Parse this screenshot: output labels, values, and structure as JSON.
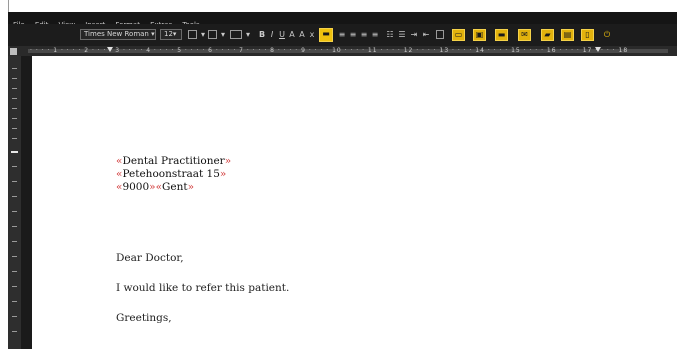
{
  "menu": [
    "File",
    "Edit",
    "View",
    "Insert",
    "Format",
    "Extras",
    "Tools"
  ],
  "toolbar": {
    "style_value": "Times New Roman",
    "size_value": "12",
    "text_glyphs": [
      "B",
      "I",
      "U",
      "A",
      "A",
      "x"
    ],
    "align_glyphs": [
      "≡",
      "≡",
      "≡",
      "≡"
    ],
    "accent": "#e2b20d"
  },
  "ruler": {
    "text": "· · · · 1 · · · · 2 · · · · 3 · · · · 4 · · · · 5 · · · · 6 · · · · 7 · · · · 8 · · · · 9 · · · · 10 · · · · 11 · · · · 12 · · · · 13 · · · · 14 · · · · 15 · · · · 16 · · · · 17 · · · · 18"
  },
  "letter": {
    "address": [
      {
        "open": "«",
        "field": "Dental Practitioner",
        "close": "»"
      },
      {
        "open": "«",
        "field": "Petehoonstraat 15",
        "close": "»"
      },
      {
        "open": "«",
        "field": "9000",
        "mid": "»«",
        "field2": "Gent",
        "close": "»"
      }
    ],
    "salutation": "Dear Doctor,",
    "body": "I would like to refer this patient.",
    "closing": "Greetings,"
  }
}
